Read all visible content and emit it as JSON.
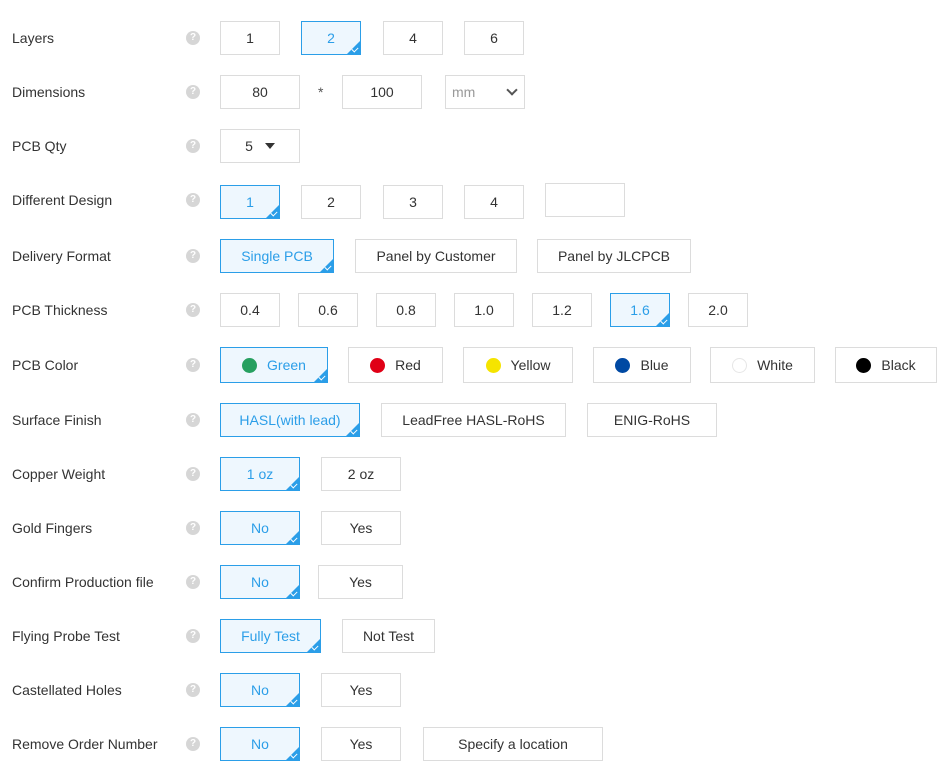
{
  "help_glyph": "?",
  "layers": {
    "label": "Layers",
    "options": [
      "1",
      "2",
      "4",
      "6"
    ],
    "selected": "2"
  },
  "dimensions": {
    "label": "Dimensions",
    "width": "80",
    "separator": "*",
    "height": "100",
    "unit": "mm"
  },
  "pcb_qty": {
    "label": "PCB Qty",
    "value": "5"
  },
  "different_design": {
    "label": "Different Design",
    "options": [
      "1",
      "2",
      "3",
      "4"
    ],
    "custom": "",
    "selected": "1"
  },
  "delivery_format": {
    "label": "Delivery Format",
    "options": [
      "Single PCB",
      "Panel by Customer",
      "Panel by JLCPCB"
    ],
    "selected": "Single PCB"
  },
  "pcb_thickness": {
    "label": "PCB Thickness",
    "options": [
      "0.4",
      "0.6",
      "0.8",
      "1.0",
      "1.2",
      "1.6",
      "2.0"
    ],
    "selected": "1.6"
  },
  "pcb_color": {
    "label": "PCB Color",
    "options": [
      {
        "name": "Green",
        "color": "#27a060"
      },
      {
        "name": "Red",
        "color": "#e00016"
      },
      {
        "name": "Yellow",
        "color": "#f5e400"
      },
      {
        "name": "Blue",
        "color": "#0049a3"
      },
      {
        "name": "White",
        "color": "#ffffff"
      },
      {
        "name": "Black",
        "color": "#000000"
      }
    ],
    "selected": "Green"
  },
  "surface_finish": {
    "label": "Surface Finish",
    "options": [
      "HASL(with lead)",
      "LeadFree HASL-RoHS",
      "ENIG-RoHS"
    ],
    "selected": "HASL(with lead)"
  },
  "copper_weight": {
    "label": "Copper Weight",
    "options": [
      "1 oz",
      "2 oz"
    ],
    "selected": "1 oz"
  },
  "gold_fingers": {
    "label": "Gold Fingers",
    "options": [
      "No",
      "Yes"
    ],
    "selected": "No"
  },
  "confirm_production_file": {
    "label": "Confirm Production file",
    "options": [
      "No",
      "Yes"
    ],
    "selected": "No"
  },
  "flying_probe_test": {
    "label": "Flying Probe Test",
    "options": [
      "Fully Test",
      "Not Test"
    ],
    "selected": "Fully Test"
  },
  "castellated_holes": {
    "label": "Castellated Holes",
    "options": [
      "No",
      "Yes"
    ],
    "selected": "No"
  },
  "remove_order_number": {
    "label": "Remove Order Number",
    "options": [
      "No",
      "Yes",
      "Specify a location"
    ],
    "selected": "No"
  },
  "colors": {
    "accent": "#2b9ee8",
    "border": "#dcdcdc",
    "help_icon": "#d6d6d6"
  }
}
